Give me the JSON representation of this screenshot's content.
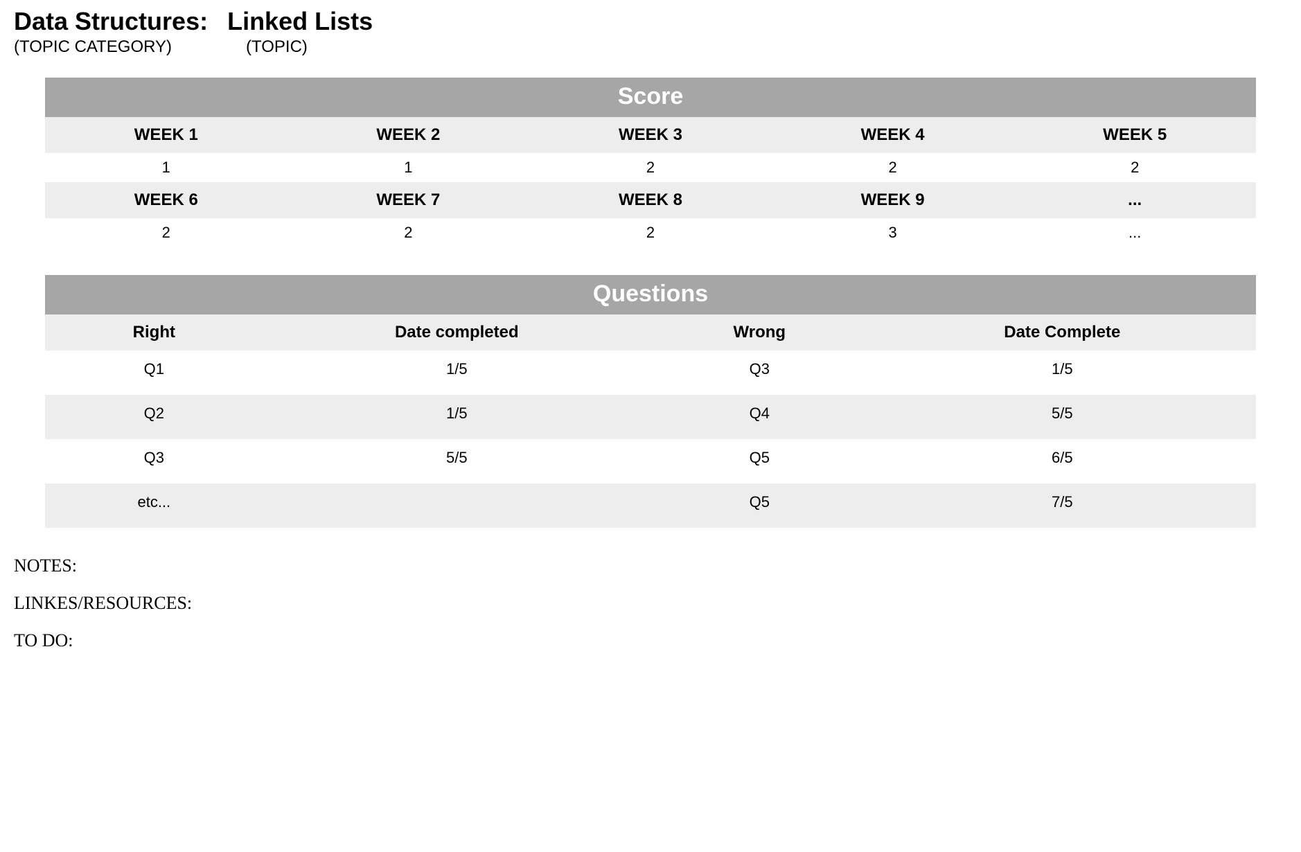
{
  "header": {
    "category": "Data Structures:",
    "topic": "Linked Lists",
    "category_sub": "(TOPIC CATEGORY)",
    "topic_sub": "(TOPIC)"
  },
  "score": {
    "title": "Score",
    "weeks_row1": [
      "WEEK 1",
      "WEEK 2",
      "WEEK 3",
      "WEEK 4",
      "WEEK 5"
    ],
    "values_row1": [
      "1",
      "1",
      "2",
      "2",
      "2"
    ],
    "weeks_row2": [
      "WEEK 6",
      "WEEK 7",
      "WEEK 8",
      "WEEK 9",
      "..."
    ],
    "values_row2": [
      "2",
      "2",
      "2",
      "3",
      "..."
    ]
  },
  "questions": {
    "title": "Questions",
    "columns": [
      "Right",
      "Date completed",
      "Wrong",
      "Date Complete"
    ],
    "rows": [
      {
        "right": "Q1",
        "date_right": "1/5",
        "wrong": "Q3",
        "date_wrong": "1/5"
      },
      {
        "right": "Q2",
        "date_right": "1/5",
        "wrong": "Q4",
        "date_wrong": "5/5"
      },
      {
        "right": "Q3",
        "date_right": "5/5",
        "wrong": "Q5",
        "date_wrong": "6/5"
      },
      {
        "right": "etc...",
        "date_right": "",
        "wrong": "Q5",
        "date_wrong": "7/5"
      }
    ]
  },
  "footer": {
    "notes": "NOTES:",
    "links": "LINKES/RESOURCES:",
    "todo": "TO DO:"
  }
}
